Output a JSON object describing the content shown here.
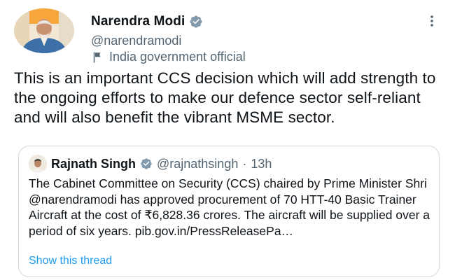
{
  "author": {
    "name": "Narendra Modi",
    "handle": "@narendramodi",
    "label": "India government official",
    "label_icon": "flag-icon",
    "verified_icon": "verified-badge-icon",
    "verified_color": "#829aab"
  },
  "tweet": {
    "text": "This is an important CCS decision which will add strength to the ongoing efforts to make our defence sector self-reliant and will also benefit the vibrant MSME sector."
  },
  "quoted_tweet": {
    "author_name": "Rajnath Singh",
    "handle": "@rajnathsingh",
    "separator": "·",
    "time": "13h",
    "text": "The Cabinet Committee on Security (CCS) chaired by Prime Minister Shri @narendramodi has approved procurement of 70 HTT-40 Basic Trainer Aircraft at the cost of ₹6,828.36 crores. The aircraft will be supplied over a period of six years. pib.gov.in/PressReleasePa…",
    "show_thread": "Show this thread"
  },
  "colors": {
    "text_primary": "#0f1419",
    "text_secondary": "#536471",
    "link": "#1d9bf0",
    "border": "#cfd9de"
  }
}
